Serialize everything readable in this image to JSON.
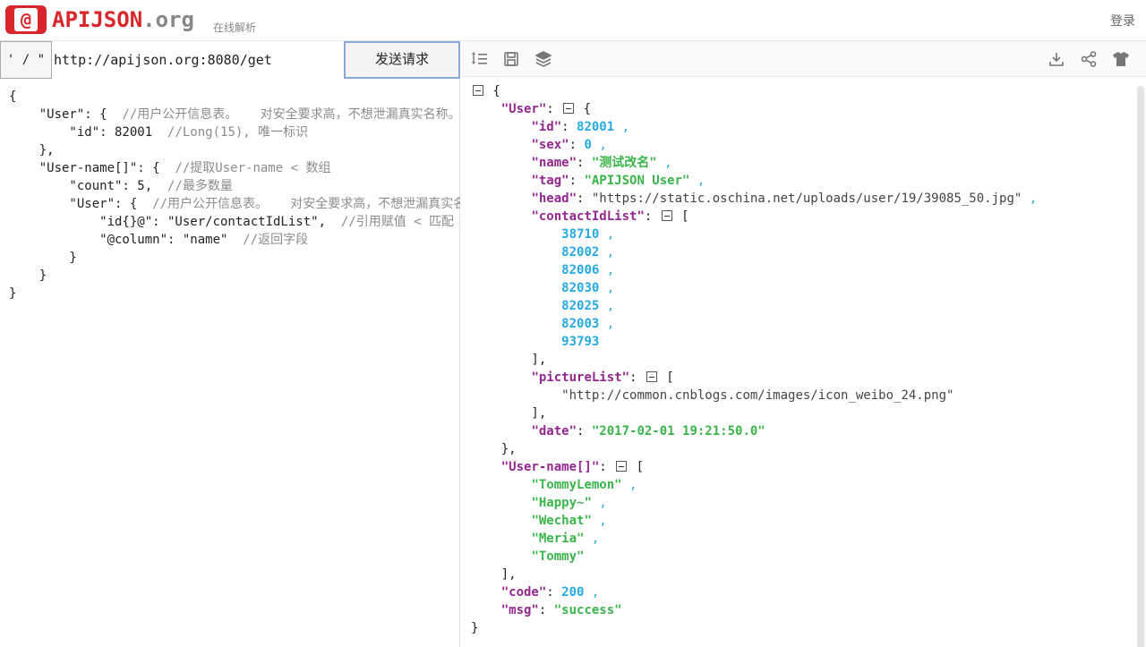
{
  "header": {
    "logo_symbol": "@",
    "logo_name": "APIJSON",
    "logo_ext": ".org",
    "subtitle": "在线解析",
    "login_label": "登录"
  },
  "request": {
    "method_label": "' / \"",
    "url_value": "http://apijson.org:8080/get",
    "send_label": "发送请求",
    "body_lines": [
      {
        "code": "{",
        "comment": ""
      },
      {
        "code": "    \"User\": {  ",
        "comment": "//用户公开信息表。   对安全要求高，不想泄漏真实名称。对"
      },
      {
        "code": "        \"id\": 82001  ",
        "comment": "//Long(15), 唯一标识"
      },
      {
        "code": "    },",
        "comment": ""
      },
      {
        "code": "    \"User-name[]\": {  ",
        "comment": "//提取User-name < 数组"
      },
      {
        "code": "        \"count\": 5,  ",
        "comment": "//最多数量"
      },
      {
        "code": "        \"User\": {  ",
        "comment": "//用户公开信息表。   对安全要求高，不想泄漏真实名"
      },
      {
        "code": "            \"id{}@\": \"User/contactIdList\",  ",
        "comment": "//引用赋值 < 匹配"
      },
      {
        "code": "            \"@column\": \"name\"  ",
        "comment": "//返回字段"
      },
      {
        "code": "        }",
        "comment": ""
      },
      {
        "code": "    }",
        "comment": ""
      },
      {
        "code": "}",
        "comment": ""
      }
    ]
  },
  "toolbar": {
    "icons": [
      "list-order-icon",
      "save-icon",
      "layers-icon",
      "download-icon",
      "share-icon",
      "shirt-icon"
    ]
  },
  "response": {
    "user_key": "\"User\"",
    "fields": {
      "id_key": "\"id\"",
      "id_val": "82001",
      "sex_key": "\"sex\"",
      "sex_val": "0",
      "name_key": "\"name\"",
      "name_val": "\"测试改名\"",
      "tag_key": "\"tag\"",
      "tag_val": "\"APIJSON User\"",
      "head_key": "\"head\"",
      "head_val": "\"https://static.oschina.net/uploads/user/19/39085_50.jpg\"",
      "contact_key": "\"contactIdList\"",
      "picture_key": "\"pictureList\"",
      "picture_val": "\"http://common.cnblogs.com/images/icon_weibo_24.png\"",
      "date_key": "\"date\"",
      "date_val": "\"2017-02-01 19:21:50.0\""
    },
    "contact_ids": [
      "38710",
      "82002",
      "82006",
      "82030",
      "82025",
      "82003",
      "93793"
    ],
    "username_key": "\"User-name[]\"",
    "usernames": [
      "\"TommyLemon\"",
      "\"Happy~\"",
      "\"Wechat\"",
      "\"Meria\"",
      "\"Tommy\""
    ],
    "code_key": "\"code\"",
    "code_val": "200",
    "msg_key": "\"msg\"",
    "msg_val": "\"success\""
  },
  "colors": {
    "brand": "#d9262c",
    "json_key": "#92278f",
    "json_number": "#25aae2",
    "json_string": "#3ab54a"
  }
}
